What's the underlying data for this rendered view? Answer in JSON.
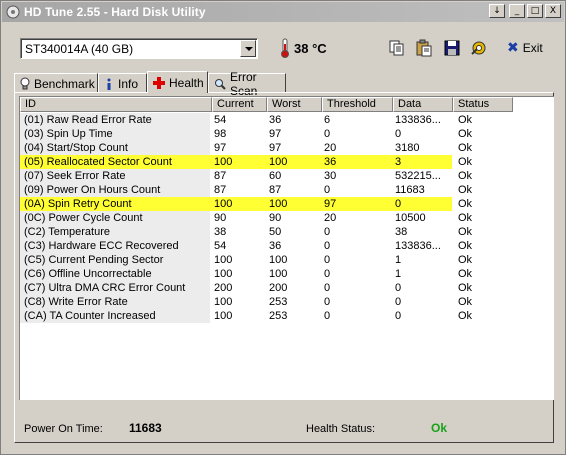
{
  "window": {
    "title": "HD Tune 2.55 - Hard Disk Utility",
    "buttons": [
      "↓",
      "_",
      "□",
      "X"
    ]
  },
  "toolbar": {
    "drive": "ST340014A (40 GB)",
    "temperature": "38 °C",
    "exit_label": "Exit"
  },
  "tabs": [
    {
      "label": "Benchmark",
      "icon": "lightbulb-icon"
    },
    {
      "label": "Info",
      "icon": "info-icon"
    },
    {
      "label": "Health",
      "icon": "red-cross-icon",
      "active": true
    },
    {
      "label": "Error Scan",
      "icon": "magnifier-icon"
    }
  ],
  "table": {
    "columns": [
      "ID",
      "Current",
      "Worst",
      "Threshold",
      "Data",
      "Status"
    ],
    "rows": [
      {
        "id": "(01) Raw Read Error Rate",
        "current": "54",
        "worst": "36",
        "threshold": "6",
        "data": "133836...",
        "status": "Ok"
      },
      {
        "id": "(03) Spin Up Time",
        "current": "98",
        "worst": "97",
        "threshold": "0",
        "data": "0",
        "status": "Ok"
      },
      {
        "id": "(04) Start/Stop Count",
        "current": "97",
        "worst": "97",
        "threshold": "20",
        "data": "3180",
        "status": "Ok"
      },
      {
        "id": "(05) Reallocated Sector Count",
        "current": "100",
        "worst": "100",
        "threshold": "36",
        "data": "3",
        "status": "Ok",
        "highlight": true
      },
      {
        "id": "(07) Seek Error Rate",
        "current": "87",
        "worst": "60",
        "threshold": "30",
        "data": "532215...",
        "status": "Ok"
      },
      {
        "id": "(09) Power On Hours Count",
        "current": "87",
        "worst": "87",
        "threshold": "0",
        "data": "11683",
        "status": "Ok"
      },
      {
        "id": "(0A) Spin Retry Count",
        "current": "100",
        "worst": "100",
        "threshold": "97",
        "data": "0",
        "status": "Ok",
        "highlight": true
      },
      {
        "id": "(0C) Power Cycle Count",
        "current": "90",
        "worst": "90",
        "threshold": "20",
        "data": "10500",
        "status": "Ok"
      },
      {
        "id": "(C2) Temperature",
        "current": "38",
        "worst": "50",
        "threshold": "0",
        "data": "38",
        "status": "Ok"
      },
      {
        "id": "(C3) Hardware ECC Recovered",
        "current": "54",
        "worst": "36",
        "threshold": "0",
        "data": "133836...",
        "status": "Ok"
      },
      {
        "id": "(C5) Current Pending Sector",
        "current": "100",
        "worst": "100",
        "threshold": "0",
        "data": "1",
        "status": "Ok"
      },
      {
        "id": "(C6) Offline Uncorrectable",
        "current": "100",
        "worst": "100",
        "threshold": "0",
        "data": "1",
        "status": "Ok"
      },
      {
        "id": "(C7) Ultra DMA CRC Error Count",
        "current": "200",
        "worst": "200",
        "threshold": "0",
        "data": "0",
        "status": "Ok"
      },
      {
        "id": "(C8) Write Error Rate",
        "current": "100",
        "worst": "253",
        "threshold": "0",
        "data": "0",
        "status": "Ok"
      },
      {
        "id": "(CA) TA Counter Increased",
        "current": "100",
        "worst": "253",
        "threshold": "0",
        "data": "0",
        "status": "Ok"
      }
    ]
  },
  "footer": {
    "power_on_label": "Power On Time:",
    "power_on_value": "11683",
    "health_label": "Health Status:",
    "health_value": "Ok"
  },
  "colors": {
    "highlight": "#ffff33",
    "ok_green": "#19a319",
    "exit_blue": "#1c3fa6"
  }
}
